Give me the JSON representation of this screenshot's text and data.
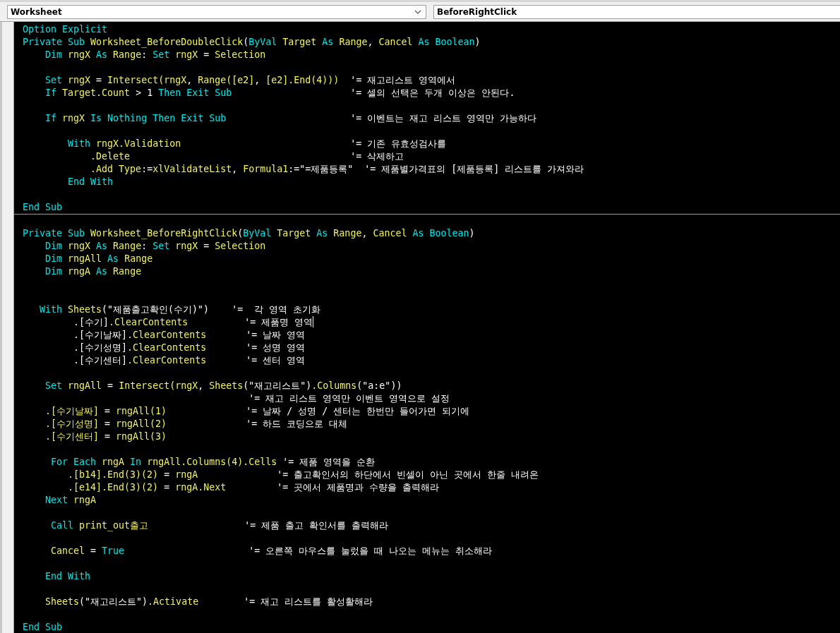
{
  "object_box": {
    "value": "Worksheet"
  },
  "procedure_box": {
    "value": "BeforeRightClick"
  },
  "code_lines": [
    {
      "kind": "code",
      "tokens": [
        {
          "kind": "kw",
          "text": "Option Explicit"
        }
      ]
    },
    {
      "kind": "code",
      "tokens": [
        {
          "kind": "kw",
          "text": "Private Sub "
        },
        {
          "kind": "id",
          "text": "Worksheet_BeforeDoubleClick"
        },
        {
          "kind": "tx",
          "text": "("
        },
        {
          "kind": "kw",
          "text": "ByVal "
        },
        {
          "kind": "id",
          "text": "Target "
        },
        {
          "kind": "kw",
          "text": "As "
        },
        {
          "kind": "id",
          "text": "Range"
        },
        {
          "kind": "tx",
          "text": ", "
        },
        {
          "kind": "id",
          "text": "Cancel "
        },
        {
          "kind": "kw",
          "text": "As "
        },
        {
          "kind": "kw",
          "text": "Boolean"
        },
        {
          "kind": "tx",
          "text": ")"
        }
      ]
    },
    {
      "kind": "code",
      "tokens": [
        {
          "kind": "kw",
          "text": "    Dim "
        },
        {
          "kind": "id",
          "text": "rngX "
        },
        {
          "kind": "kw",
          "text": "As "
        },
        {
          "kind": "id",
          "text": "Range"
        },
        {
          "kind": "tx",
          "text": ": "
        },
        {
          "kind": "kw",
          "text": "Set "
        },
        {
          "kind": "id",
          "text": "rngX"
        },
        {
          "kind": "tx",
          "text": " = "
        },
        {
          "kind": "id",
          "text": "Selection"
        }
      ]
    },
    {
      "kind": "blank"
    },
    {
      "kind": "code",
      "tokens": [
        {
          "kind": "kw",
          "text": "    Set "
        },
        {
          "kind": "id",
          "text": "rngX"
        },
        {
          "kind": "tx",
          "text": " = "
        },
        {
          "kind": "id",
          "text": "Intersect(rngX"
        },
        {
          "kind": "tx",
          "text": ", "
        },
        {
          "kind": "id",
          "text": "Range([e2]"
        },
        {
          "kind": "tx",
          "text": ", "
        },
        {
          "kind": "id",
          "text": "[e2].End(4)))"
        },
        {
          "kind": "cm",
          "text": "  '= 재고리스트 영역에서"
        }
      ]
    },
    {
      "kind": "code",
      "tokens": [
        {
          "kind": "kw",
          "text": "    If "
        },
        {
          "kind": "id",
          "text": "Target.Count"
        },
        {
          "kind": "tx",
          "text": " > 1 "
        },
        {
          "kind": "kw",
          "text": "Then Exit Sub"
        },
        {
          "kind": "cm",
          "text": "                     '= 셀의 선택은 두개 이상은 안된다."
        }
      ]
    },
    {
      "kind": "blank"
    },
    {
      "kind": "code",
      "tokens": [
        {
          "kind": "kw",
          "text": "    If "
        },
        {
          "kind": "id",
          "text": "rngX "
        },
        {
          "kind": "kw",
          "text": "Is Nothing Then Exit Sub"
        },
        {
          "kind": "cm",
          "text": "                      '= 이벤트는 재고 리스트 영역만 가능하다"
        }
      ]
    },
    {
      "kind": "blank"
    },
    {
      "kind": "code",
      "tokens": [
        {
          "kind": "kw",
          "text": "        With "
        },
        {
          "kind": "id",
          "text": "rngX.Validation"
        },
        {
          "kind": "cm",
          "text": "                              '= 기존 유효성검사를"
        }
      ]
    },
    {
      "kind": "code",
      "tokens": [
        {
          "kind": "id",
          "text": "            .Delete"
        },
        {
          "kind": "cm",
          "text": "                                       '= 삭제하고"
        }
      ]
    },
    {
      "kind": "code",
      "tokens": [
        {
          "kind": "id",
          "text": "            .Add Type"
        },
        {
          "kind": "tx",
          "text": ":="
        },
        {
          "kind": "id",
          "text": "xlValidateList"
        },
        {
          "kind": "tx",
          "text": ", "
        },
        {
          "kind": "id",
          "text": "Formula1"
        },
        {
          "kind": "tx",
          "text": ":=\"=제품등록\""
        },
        {
          "kind": "cm",
          "text": "  '= 제품별가격표의 [제품등록] 리스트를 가져와라"
        }
      ]
    },
    {
      "kind": "code",
      "tokens": [
        {
          "kind": "kw",
          "text": "        End With"
        }
      ]
    },
    {
      "kind": "blank"
    },
    {
      "kind": "code",
      "tokens": [
        {
          "kind": "kw",
          "text": "End Sub"
        }
      ]
    },
    {
      "kind": "separator"
    },
    {
      "kind": "blank"
    },
    {
      "kind": "code",
      "tokens": [
        {
          "kind": "kw",
          "text": "Private Sub "
        },
        {
          "kind": "id",
          "text": "Worksheet_BeforeRightClick"
        },
        {
          "kind": "tx",
          "text": "("
        },
        {
          "kind": "kw",
          "text": "ByVal "
        },
        {
          "kind": "id",
          "text": "Target "
        },
        {
          "kind": "kw",
          "text": "As "
        },
        {
          "kind": "id",
          "text": "Range"
        },
        {
          "kind": "tx",
          "text": ", "
        },
        {
          "kind": "id",
          "text": "Cancel "
        },
        {
          "kind": "kw",
          "text": "As "
        },
        {
          "kind": "kw",
          "text": "Boolean"
        },
        {
          "kind": "tx",
          "text": ")"
        }
      ]
    },
    {
      "kind": "code",
      "tokens": [
        {
          "kind": "kw",
          "text": "    Dim "
        },
        {
          "kind": "id",
          "text": "rngX "
        },
        {
          "kind": "kw",
          "text": "As "
        },
        {
          "kind": "id",
          "text": "Range"
        },
        {
          "kind": "tx",
          "text": ": "
        },
        {
          "kind": "kw",
          "text": "Set "
        },
        {
          "kind": "id",
          "text": "rngX"
        },
        {
          "kind": "tx",
          "text": " = "
        },
        {
          "kind": "id",
          "text": "Selection"
        }
      ]
    },
    {
      "kind": "code",
      "tokens": [
        {
          "kind": "kw",
          "text": "    Dim "
        },
        {
          "kind": "id",
          "text": "rngAll "
        },
        {
          "kind": "kw",
          "text": "As "
        },
        {
          "kind": "id",
          "text": "Range"
        }
      ]
    },
    {
      "kind": "code",
      "tokens": [
        {
          "kind": "kw",
          "text": "    Dim "
        },
        {
          "kind": "id",
          "text": "rngA "
        },
        {
          "kind": "kw",
          "text": "As "
        },
        {
          "kind": "id",
          "text": "Range"
        }
      ]
    },
    {
      "kind": "blank"
    },
    {
      "kind": "blank"
    },
    {
      "kind": "code",
      "tokens": [
        {
          "kind": "kw",
          "text": "   With "
        },
        {
          "kind": "id",
          "text": "Sheets"
        },
        {
          "kind": "tx",
          "text": "(\"제품출고확인(수기)\")"
        },
        {
          "kind": "cm",
          "text": "    '=  각 영역 초기화"
        }
      ]
    },
    {
      "kind": "code",
      "tokens": [
        {
          "kind": "tx",
          "text": "         .[수기]"
        },
        {
          "kind": "id",
          "text": ".ClearContents"
        },
        {
          "kind": "cm",
          "text": "          '= 제품명 영역"
        },
        {
          "kind": "caret"
        }
      ]
    },
    {
      "kind": "code",
      "tokens": [
        {
          "kind": "tx",
          "text": "         .[수기날짜]"
        },
        {
          "kind": "id",
          "text": ".ClearContents"
        },
        {
          "kind": "cm",
          "text": "       '= 날짜 영역"
        }
      ]
    },
    {
      "kind": "code",
      "tokens": [
        {
          "kind": "tx",
          "text": "         .[수기성명]"
        },
        {
          "kind": "id",
          "text": ".ClearContents"
        },
        {
          "kind": "cm",
          "text": "       '= 성명 영역"
        }
      ]
    },
    {
      "kind": "code",
      "tokens": [
        {
          "kind": "tx",
          "text": "         .[수기센터]"
        },
        {
          "kind": "id",
          "text": ".ClearContents"
        },
        {
          "kind": "cm",
          "text": "       '= 센터 영역"
        }
      ]
    },
    {
      "kind": "blank"
    },
    {
      "kind": "code",
      "tokens": [
        {
          "kind": "kw",
          "text": "    Set "
        },
        {
          "kind": "id",
          "text": "rngAll"
        },
        {
          "kind": "tx",
          "text": " = "
        },
        {
          "kind": "id",
          "text": "Intersect(rngX"
        },
        {
          "kind": "tx",
          "text": ", "
        },
        {
          "kind": "id",
          "text": "Sheets"
        },
        {
          "kind": "tx",
          "text": "(\"재고리스트\")"
        },
        {
          "kind": "id",
          "text": ".Columns"
        },
        {
          "kind": "tx",
          "text": "(\"a:e\"))"
        }
      ]
    },
    {
      "kind": "code",
      "tokens": [
        {
          "kind": "cm",
          "text": "                                        '= 재고 리스트 영역만 이벤트 영역으로 설정"
        }
      ]
    },
    {
      "kind": "code",
      "tokens": [
        {
          "kind": "id",
          "text": "    .[수기날짜]"
        },
        {
          "kind": "tx",
          "text": " = "
        },
        {
          "kind": "id",
          "text": "rngAll(1)"
        },
        {
          "kind": "cm",
          "text": "              '= 날짜 / 성명 / 센터는 한번만 들어가면 되기에"
        }
      ]
    },
    {
      "kind": "code",
      "tokens": [
        {
          "kind": "id",
          "text": "    .[수기성명]"
        },
        {
          "kind": "tx",
          "text": " = "
        },
        {
          "kind": "id",
          "text": "rngAll(2)"
        },
        {
          "kind": "cm",
          "text": "              '= 하드 코딩으로 대체"
        }
      ]
    },
    {
      "kind": "code",
      "tokens": [
        {
          "kind": "id",
          "text": "    .[수기센터]"
        },
        {
          "kind": "tx",
          "text": " = "
        },
        {
          "kind": "id",
          "text": "rngAll(3)"
        }
      ]
    },
    {
      "kind": "blank"
    },
    {
      "kind": "code",
      "tokens": [
        {
          "kind": "kw",
          "text": "     For Each "
        },
        {
          "kind": "id",
          "text": "rngA "
        },
        {
          "kind": "kw",
          "text": "In "
        },
        {
          "kind": "id",
          "text": "rngAll.Columns(4).Cells"
        },
        {
          "kind": "cm",
          "text": " '= 제품 영역을 순환"
        }
      ]
    },
    {
      "kind": "code",
      "tokens": [
        {
          "kind": "id",
          "text": "        .[b14].End(3)(2)"
        },
        {
          "kind": "tx",
          "text": " = "
        },
        {
          "kind": "id",
          "text": "rngA"
        },
        {
          "kind": "cm",
          "text": "              '= 출고확인서의 하단에서 빈셀이 아닌 곳에서 한줄 내려온"
        }
      ]
    },
    {
      "kind": "code",
      "tokens": [
        {
          "kind": "id",
          "text": "        .[e14].End(3)(2)"
        },
        {
          "kind": "tx",
          "text": " = "
        },
        {
          "kind": "id",
          "text": "rngA.Next"
        },
        {
          "kind": "cm",
          "text": "         '= 곳에서 제품명과 수량을 출력해라"
        }
      ]
    },
    {
      "kind": "code",
      "tokens": [
        {
          "kind": "kw",
          "text": "    Next "
        },
        {
          "kind": "id",
          "text": "rngA"
        }
      ]
    },
    {
      "kind": "blank"
    },
    {
      "kind": "code",
      "tokens": [
        {
          "kind": "kw",
          "text": "     Call "
        },
        {
          "kind": "id",
          "text": "print_out출고"
        },
        {
          "kind": "cm",
          "text": "                 '= 제품 출고 확인서를 출력해라"
        }
      ]
    },
    {
      "kind": "blank"
    },
    {
      "kind": "code",
      "tokens": [
        {
          "kind": "id",
          "text": "     Cancel"
        },
        {
          "kind": "tx",
          "text": " = "
        },
        {
          "kind": "kw",
          "text": "True"
        },
        {
          "kind": "cm",
          "text": "                      '= 오른쪽 마우스를 눌렀을 때 나오는 메뉴는 취소해라"
        }
      ]
    },
    {
      "kind": "blank"
    },
    {
      "kind": "code",
      "tokens": [
        {
          "kind": "kw",
          "text": "    End With"
        }
      ]
    },
    {
      "kind": "blank"
    },
    {
      "kind": "code",
      "tokens": [
        {
          "kind": "id",
          "text": "    Sheets"
        },
        {
          "kind": "tx",
          "text": "(\"재고리스트\")"
        },
        {
          "kind": "id",
          "text": ".Activate"
        },
        {
          "kind": "cm",
          "text": "        '= 재고 리스트를 활성활해라"
        }
      ]
    },
    {
      "kind": "blank"
    },
    {
      "kind": "code",
      "tokens": [
        {
          "kind": "kw",
          "text": "End Sub"
        }
      ]
    }
  ]
}
